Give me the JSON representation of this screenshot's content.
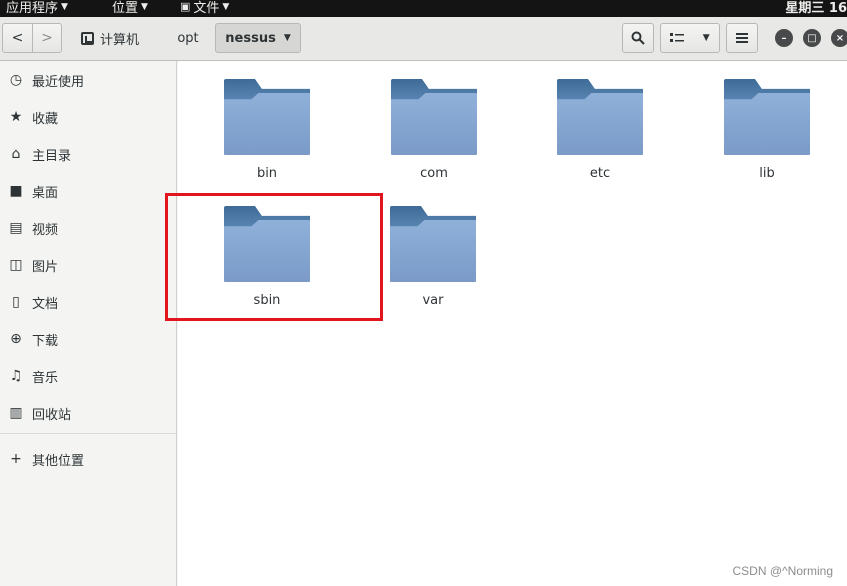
{
  "top_bar": {
    "menus": [
      {
        "label": "应用程序",
        "icon": ""
      },
      {
        "label": "位置",
        "icon": ""
      },
      {
        "label": "文件",
        "icon": "files-icon"
      }
    ],
    "clock": "星期三 16"
  },
  "header": {
    "nav_back": "‹",
    "nav_forward": "›",
    "path": [
      {
        "label": "计算机",
        "icon": "computer-icon"
      },
      {
        "label": "opt"
      },
      {
        "label": "nessus",
        "active": true
      }
    ]
  },
  "sidebar": {
    "items": [
      {
        "label": "最近使用",
        "icon": "clock-icon",
        "glyph": "◷"
      },
      {
        "label": "收藏",
        "icon": "star-icon",
        "glyph": "★"
      },
      {
        "label": "主目录",
        "icon": "home-icon",
        "glyph": "⌂"
      },
      {
        "label": "桌面",
        "icon": "desktop-icon",
        "glyph": "■"
      },
      {
        "label": "视频",
        "icon": "video-icon",
        "glyph": "▤"
      },
      {
        "label": "图片",
        "icon": "picture-icon",
        "glyph": "◫"
      },
      {
        "label": "文档",
        "icon": "document-icon",
        "glyph": "▯"
      },
      {
        "label": "下载",
        "icon": "download-icon",
        "glyph": "⊕"
      },
      {
        "label": "音乐",
        "icon": "music-icon",
        "glyph": "♫"
      },
      {
        "label": "回收站",
        "icon": "trash-icon",
        "glyph": "▥"
      },
      {
        "label": "其他位置",
        "icon": "plus-icon",
        "glyph": "+"
      }
    ]
  },
  "files": [
    {
      "name": "bin"
    },
    {
      "name": "com"
    },
    {
      "name": "etc"
    },
    {
      "name": "lib"
    },
    {
      "name": "sbin",
      "highlighted": true
    },
    {
      "name": "var"
    }
  ],
  "watermark": "CSDN @^Norming",
  "colors": {
    "highlight": "#e0151e",
    "folder_front": "#8fb1d9",
    "folder_tab": "#3d6a96"
  }
}
